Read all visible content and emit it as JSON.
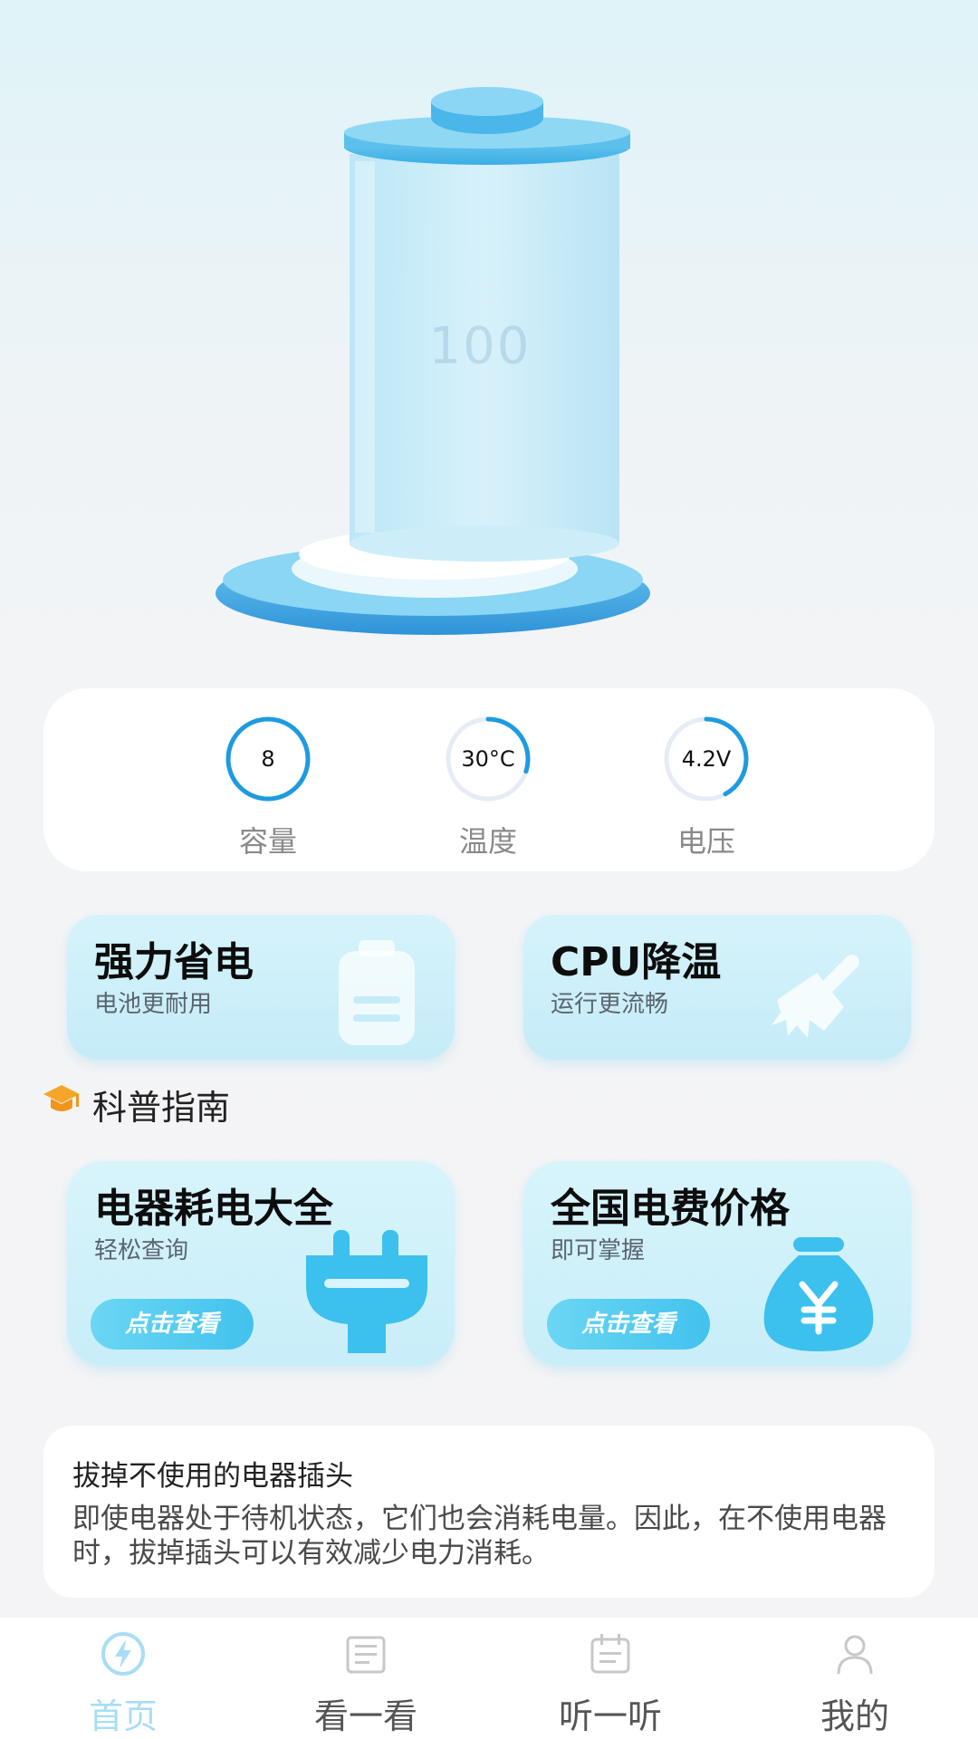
{
  "hero": {
    "battery_level": "100"
  },
  "stats": [
    {
      "value": "8",
      "label": "容量",
      "progress": 1.0
    },
    {
      "value": "30°C",
      "label": "温度",
      "progress": 0.3
    },
    {
      "value": "4.2V",
      "label": "电压",
      "progress": 0.42
    }
  ],
  "features": [
    {
      "title": "强力省电",
      "subtitle": "电池更耐用",
      "icon": "battery-icon"
    },
    {
      "title": "CPU降温",
      "subtitle": "运行更流畅",
      "icon": "broom-icon"
    }
  ],
  "section": {
    "title": "科普指南",
    "icon": "graduation-cap-icon"
  },
  "guides": [
    {
      "title": "电器耗电大全",
      "subtitle": "轻松查询",
      "button": "点击查看",
      "icon": "plug-icon"
    },
    {
      "title": "全国电费价格",
      "subtitle": "即可掌握",
      "button": "点击查看",
      "icon": "money-bag-icon"
    }
  ],
  "tip": {
    "title": "拔掉不使用的电器插头",
    "body": "即使电器处于待机状态，它们也会消耗电量。因此，在不使用电器时，拔掉插头可以有效减少电力消耗。"
  },
  "nav": [
    {
      "label": "首页",
      "icon": "lightning-icon",
      "active": true
    },
    {
      "label": "看一看",
      "icon": "newspaper-icon",
      "active": false
    },
    {
      "label": "听一听",
      "icon": "calendar-icon",
      "active": false
    },
    {
      "label": "我的",
      "icon": "user-icon",
      "active": false
    }
  ],
  "colors": {
    "accent": "#1e9be0",
    "card_bg": "#cdeff9",
    "button": "#42c2ee",
    "nav_active": "#a8def5"
  }
}
